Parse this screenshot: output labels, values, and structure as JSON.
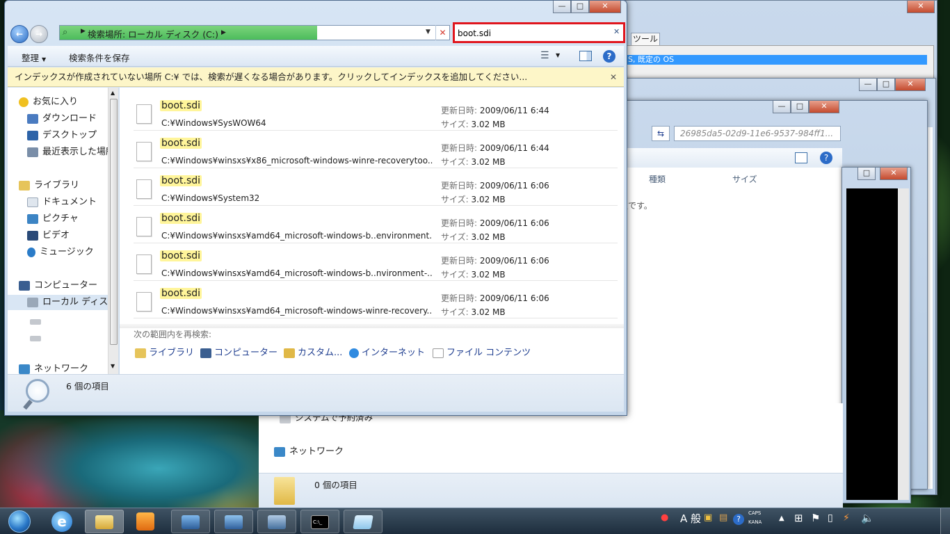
{
  "search": {
    "query": "boot.sdi"
  },
  "address": {
    "text": "検索場所: ローカル ディスク (C:)"
  },
  "command_bar": {
    "organize": "整理",
    "save_search": "検索条件を保存"
  },
  "info_bar": {
    "text": "インデックスが作成されていない場所 C:¥ では、検索が遅くなる場合があります。クリックしてインデックスを追加してください..."
  },
  "nav": {
    "favorites": "お気に入り",
    "downloads": "ダウンロード",
    "desktop": "デスクトップ",
    "recent": "最近表示した場所",
    "libraries": "ライブラリ",
    "documents": "ドキュメント",
    "pictures": "ピクチャ",
    "videos": "ビデオ",
    "music": "ミュージック",
    "computer": "コンピューター",
    "local_disk": "ローカル ディスク",
    "network": "ネットワーク"
  },
  "labels": {
    "modified": "更新日時:",
    "size": "サイズ:"
  },
  "results": [
    {
      "name": "boot.sdi",
      "path": "C:¥Windows¥SysWOW64",
      "date": "2009/06/11 6:44",
      "size": "3.02 MB"
    },
    {
      "name": "boot.sdi",
      "path": "C:¥Windows¥winsxs¥x86_microsoft-windows-winre-recoverytoo...",
      "date": "2009/06/11 6:44",
      "size": "3.02 MB"
    },
    {
      "name": "boot.sdi",
      "path": "C:¥Windows¥System32",
      "date": "2009/06/11 6:06",
      "size": "3.02 MB"
    },
    {
      "name": "boot.sdi",
      "path": "C:¥Windows¥winsxs¥amd64_microsoft-windows-b..environment...",
      "date": "2009/06/11 6:06",
      "size": "3.02 MB"
    },
    {
      "name": "boot.sdi",
      "path": "C:¥Windows¥winsxs¥amd64_microsoft-windows-b..nvironment-...",
      "date": "2009/06/11 6:06",
      "size": "3.02 MB"
    },
    {
      "name": "boot.sdi",
      "path": "C:¥Windows¥winsxs¥amd64_microsoft-windows-winre-recovery...",
      "date": "2009/06/11 6:06",
      "size": "3.02 MB"
    }
  ],
  "research": {
    "heading": "次の範囲内を再検索:",
    "library": "ライブラリ",
    "computer": "コンピューター",
    "custom": "カスタム...",
    "internet": "インターネット",
    "file_contents": "ファイル コンテンツ"
  },
  "status": {
    "count": "6 個の項目"
  },
  "bg": {
    "tools_tab": "ツール",
    "default_os": "S, 既定の OS",
    "guid_path": "26985da5-02d9-11e6-9537-984ff1...",
    "col_type": "種類",
    "col_size": "サイズ",
    "fragment": "定です。",
    "system_reserved": "システムで予約済み",
    "network": "ネットワーク",
    "count": "0 個の項目"
  },
  "tray": {
    "ime_mode": "A 般",
    "caps": "CAPS",
    "kana": "KANA"
  }
}
